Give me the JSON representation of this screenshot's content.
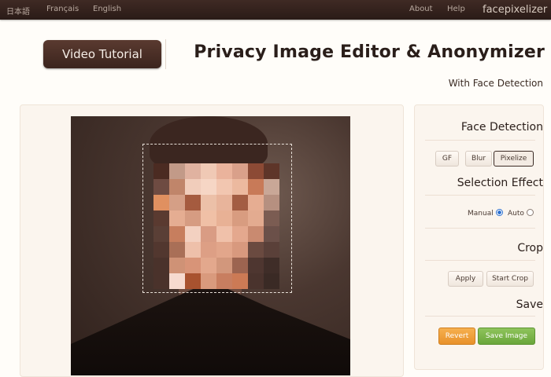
{
  "nav": {
    "brand": "facepixelizer",
    "help": "Help",
    "about": "About",
    "lang_en": "English",
    "lang_fr": "Français",
    "lang_ja": "日本語"
  },
  "header": {
    "title": "Privacy Image Editor & Anonymizer",
    "video_button": "Video Tutorial",
    "subtitle": "With Face Detection"
  },
  "panel": {
    "face_detection": "Face Detection",
    "pixelize": "Pixelize",
    "blur": "Blur",
    "gf": "GF",
    "selection_effect": "Selection Effect",
    "auto": "Auto",
    "manual": "Manual",
    "selected_mode": "Manual",
    "crop": "Crop",
    "start_crop": "Start Crop",
    "apply": "Apply",
    "save": "Save",
    "save_image": "Save Image",
    "revert": "Revert"
  },
  "editor": {
    "effect": "Pixelize",
    "pixel_grid": [
      [
        "#4b2b22",
        "#c29a88",
        "#e0b2a0",
        "#f0c9b5",
        "#eab39c",
        "#d9a08a",
        "#8c4a35",
        "#5e3529"
      ],
      [
        "#6e4b42",
        "#c0856a",
        "#f1cdbb",
        "#f6d6c5",
        "#f2c6b0",
        "#ecb99f",
        "#c87a58",
        "#c9a797"
      ],
      [
        "#e09060",
        "#d59f86",
        "#a55b3f",
        "#ecc0a8",
        "#e8b49b",
        "#a35d43",
        "#e6ad92",
        "#b69080"
      ],
      [
        "#5a3a30",
        "#e5ad92",
        "#d69c82",
        "#f0c0a6",
        "#e8b195",
        "#d89c80",
        "#e3ab90",
        "#7b5c52"
      ],
      [
        "#5a3f36",
        "#c77e5e",
        "#f3d1c1",
        "#d99c84",
        "#f0c1aa",
        "#e4a88e",
        "#c98a70",
        "#6b5049"
      ],
      [
        "#52372f",
        "#a96f57",
        "#eec0aa",
        "#dd9f85",
        "#e2a68b",
        "#d8997e",
        "#6a4a40",
        "#5a4039"
      ],
      [
        "#4a322b",
        "#cf9276",
        "#d89478",
        "#e3a88d",
        "#d2977c",
        "#9c6450",
        "#4e3630",
        "#3f2d28"
      ],
      [
        "#4a322b",
        "#f6dacf",
        "#a8522f",
        "#d99a7d",
        "#c87e60",
        "#cc7a55",
        "#4a332d",
        "#3a2a25"
      ]
    ]
  }
}
